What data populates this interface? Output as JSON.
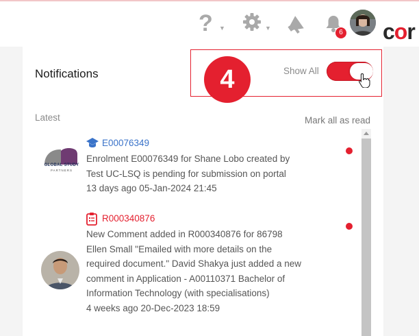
{
  "header": {
    "icons": [
      "help-icon",
      "gear-icon",
      "megaphone-icon",
      "bell-icon"
    ],
    "bell_badge": "6",
    "brand_prefix": "c",
    "brand_o": "o",
    "brand_suffix": "r"
  },
  "panel": {
    "title": "Notifications",
    "show_all_label": "Show All",
    "show_all_on": true,
    "step_number": "4",
    "latest_label": "Latest",
    "mark_all_read": "Mark all as read"
  },
  "notifications": [
    {
      "id": "E00076349",
      "type_icon": "graduation-cap-icon",
      "sender_logo_text": "GLOBAL STUDY",
      "sender_logo_sub": "PARTNERS",
      "body": "Enrolment E00076349 for Shane Lobo created by Test UC-LSQ is pending for submission on portal",
      "time": "13 days ago 05-Jan-2024 21:45",
      "unread": true
    },
    {
      "id": "R000340876",
      "type_icon": "clipboard-list-icon",
      "body": "New Comment added in R000340876 for 86798 Ellen Small \"Emailed with more details on the required document.\" David Shakya just added a new comment in Application - A00110371 Bachelor of Information Technology (with specialisations)",
      "time": "4 weeks ago 20-Dec-2023 18:59",
      "unread": true
    }
  ],
  "colors": {
    "accent": "#e4202f",
    "link_blue": "#3a73c9",
    "icon_grey": "#a9a9a9"
  }
}
